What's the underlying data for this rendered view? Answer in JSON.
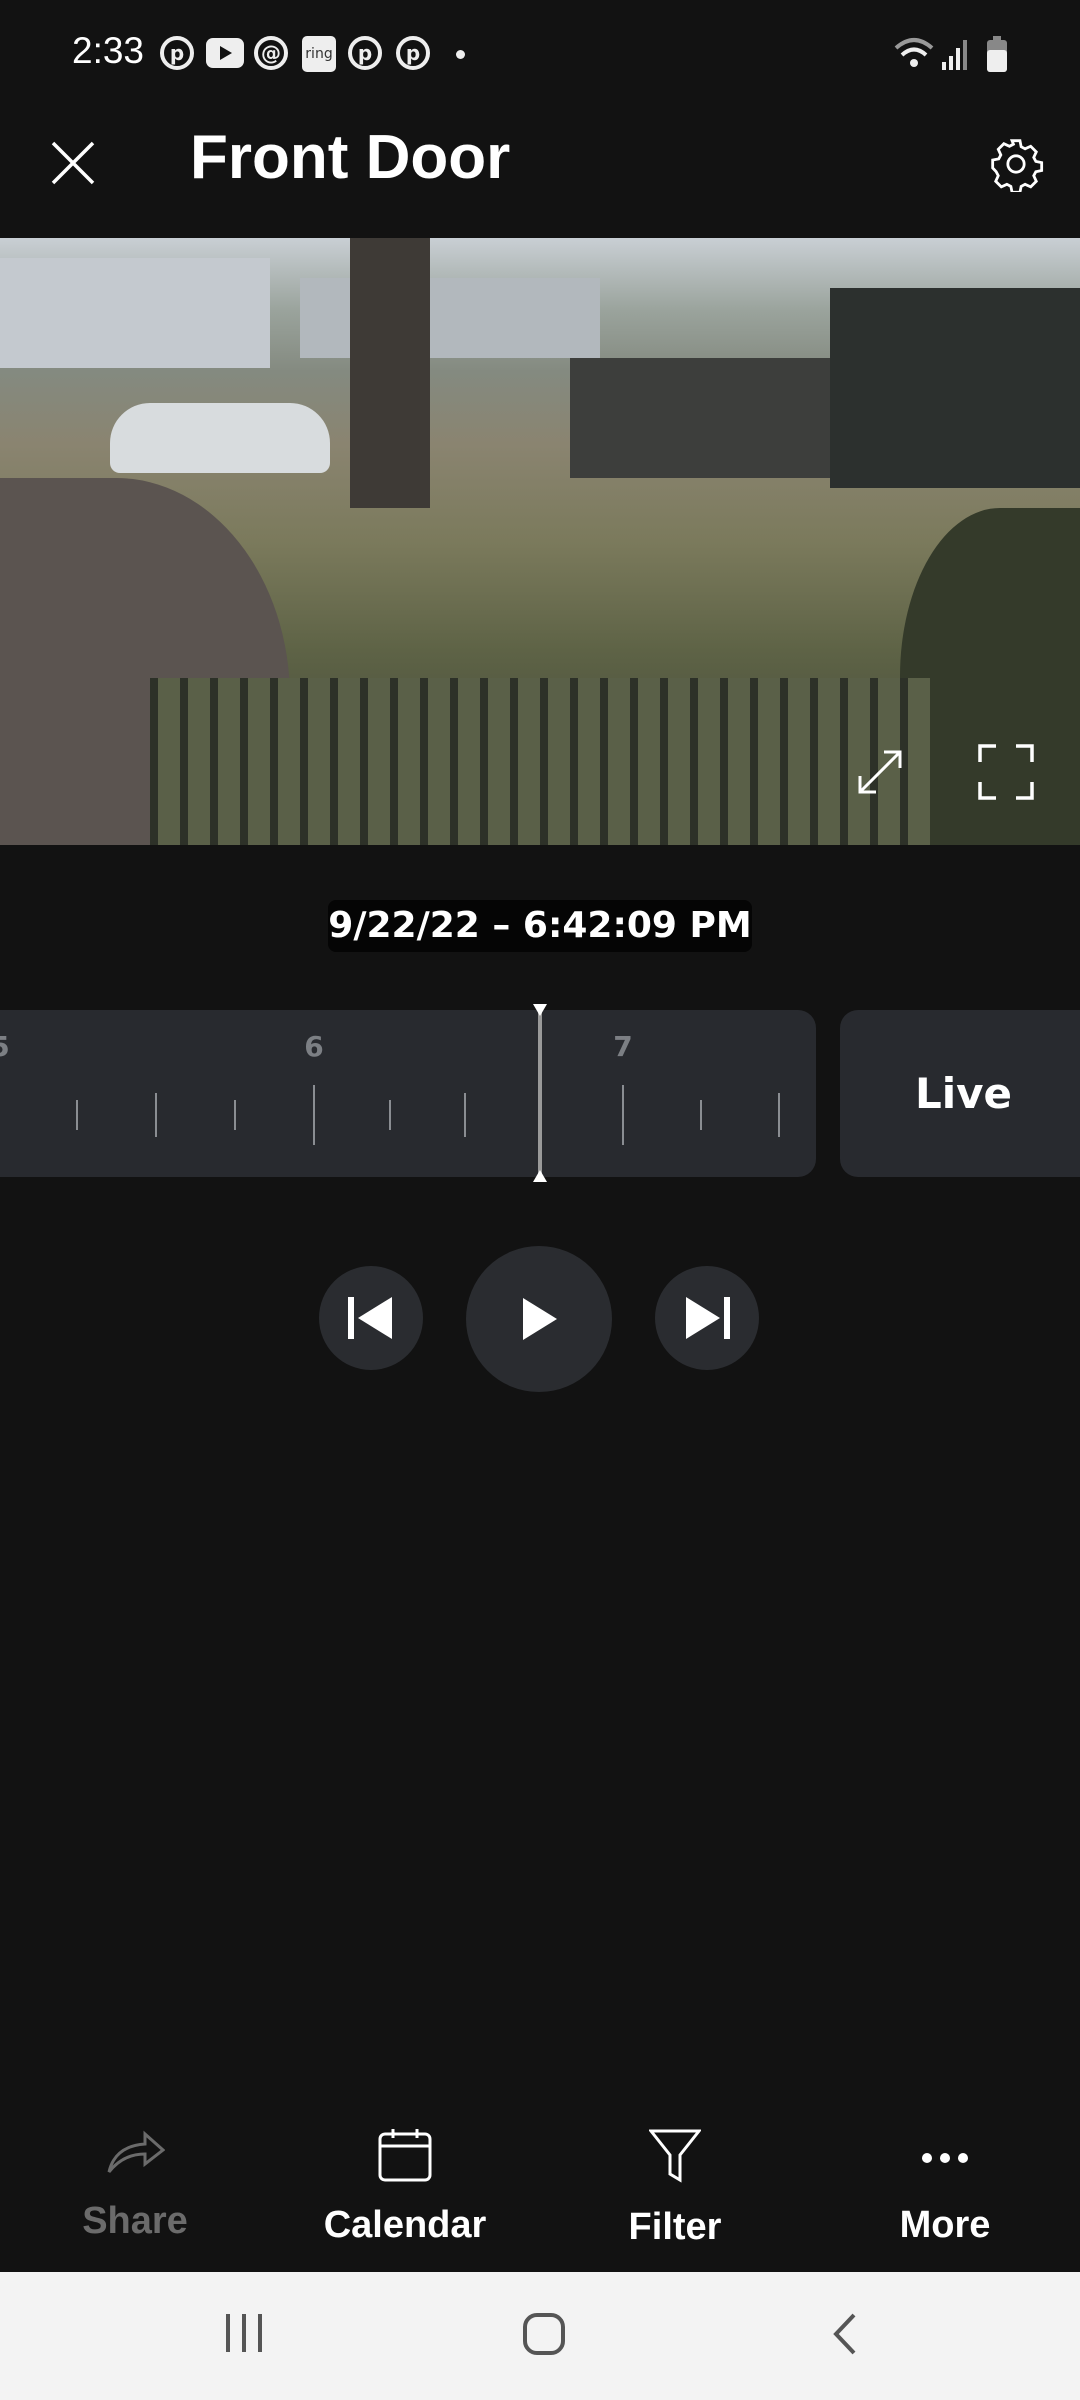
{
  "status_bar": {
    "time": "2:33",
    "notification_icons": [
      "pinterest-icon",
      "youtube-icon",
      "threads-icon",
      "ring-icon",
      "pinterest-icon",
      "pinterest-icon",
      "dot-icon"
    ],
    "ring_label": "ring",
    "system_icons": [
      "wifi-icon",
      "signal-icon",
      "battery-icon"
    ]
  },
  "header": {
    "title": "Front Door",
    "close_icon": "close-icon",
    "settings_icon": "gear-icon"
  },
  "video": {
    "expand_icon": "expand-icon",
    "fullscreen_icon": "fullscreen-icon"
  },
  "timestamp": "9/22/22 – 6:42:09 PM",
  "timeline": {
    "labels": [
      "5",
      "6",
      "7"
    ],
    "live_label": "Live"
  },
  "controls": {
    "previous": "skip-previous-icon",
    "play": "play-icon",
    "next": "skip-next-icon"
  },
  "toolbar": {
    "items": [
      {
        "label": "Share",
        "icon": "share-icon",
        "enabled": false
      },
      {
        "label": "Calendar",
        "icon": "calendar-icon",
        "enabled": true
      },
      {
        "label": "Filter",
        "icon": "filter-icon",
        "enabled": true
      },
      {
        "label": "More",
        "icon": "more-icon",
        "enabled": true
      }
    ]
  },
  "colors": {
    "background": "#121212",
    "panel": "#282a2f",
    "disabled": "#6b6b6b"
  }
}
